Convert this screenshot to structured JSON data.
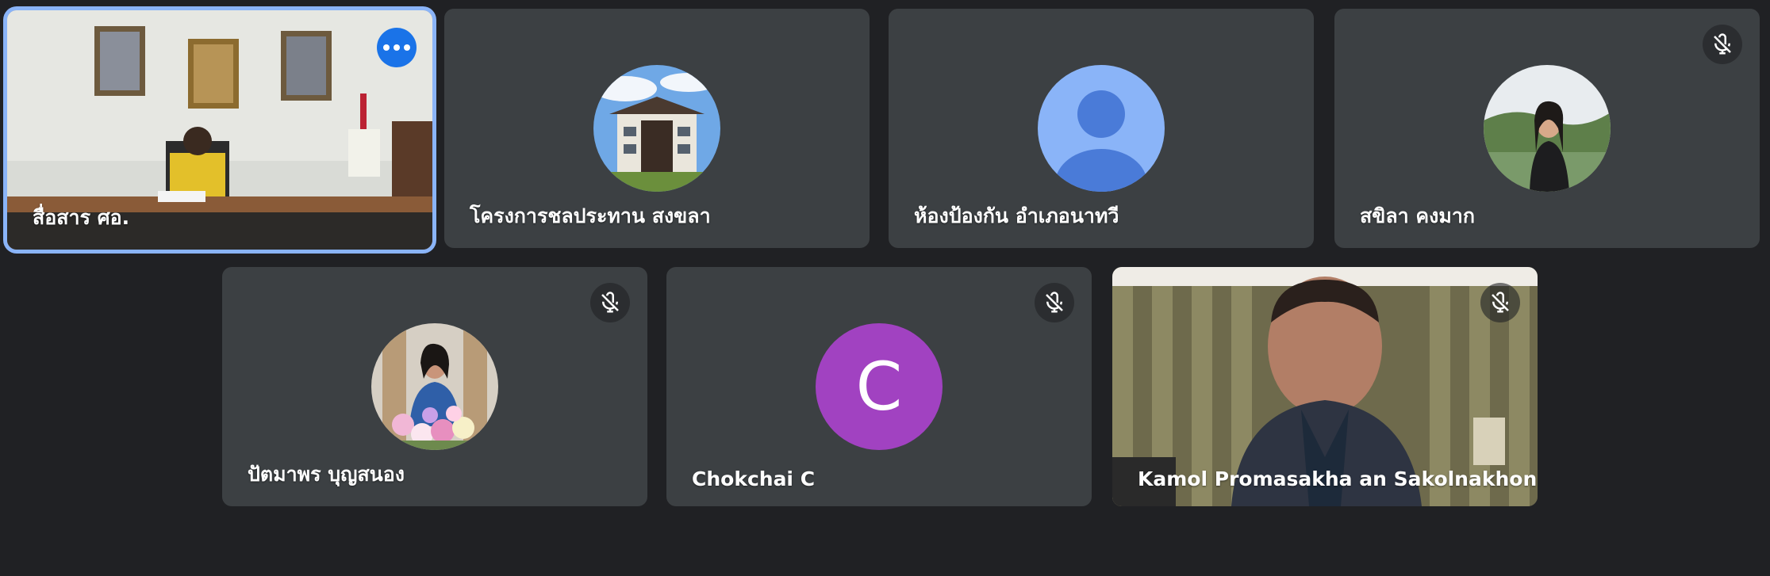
{
  "participants": [
    {
      "name": "สื่อสาร ศอ.",
      "type": "video-office",
      "muted": false,
      "active": true
    },
    {
      "name": "โครงการชลประทาน สงขลา",
      "type": "avatar-building",
      "muted": false
    },
    {
      "name": "ห้องป้องกัน อำเภอนาทวี",
      "type": "avatar-default",
      "muted": false
    },
    {
      "name": "สขิลา คงมาก",
      "type": "avatar-photo-woman",
      "muted": true
    },
    {
      "name": "ปัตมาพร บุญสนอง",
      "type": "avatar-photo-flowers",
      "muted": true
    },
    {
      "name": "Chokchai C",
      "type": "avatar-letter",
      "letter": "C",
      "color": "#a142c1",
      "muted": true
    },
    {
      "name": "Kamol Promasakha an Sakolnakhon",
      "type": "video-man",
      "muted": true
    }
  ],
  "colors": {
    "background": "#202124",
    "tile": "#3c4043",
    "active_border": "#8ab4f8",
    "more_button": "#1a73e8",
    "default_avatar_bg": "#8ab4f8",
    "default_avatar_fg": "#4a7bd8"
  },
  "icons": {
    "more_options": "more-horiz-icon",
    "muted": "mic-off-icon"
  }
}
